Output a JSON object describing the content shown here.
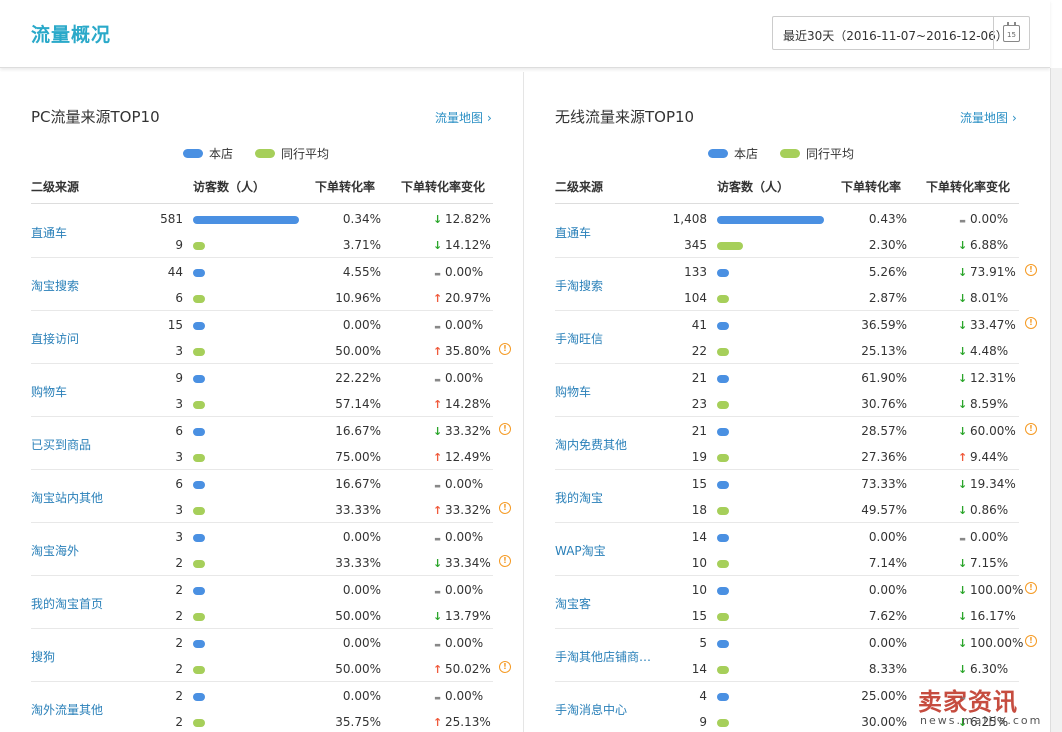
{
  "page_title": "流量概况",
  "date_range": "最近30天（2016-11-07~2016-12-06）",
  "calendar_day": "15",
  "colors": {
    "store": "#4a90e2",
    "peer": "#a6cf5a",
    "link": "#2a80b9",
    "title": "#2aa9c9"
  },
  "legend": {
    "store": "本店",
    "peer": "同行平均"
  },
  "columns": {
    "source": "二级来源",
    "visitors": "访客数（人）",
    "rate": "下单转化率",
    "change": "下单转化率变化"
  },
  "map_link": "流量地图",
  "panels": [
    {
      "title": "PC流量来源TOP10",
      "max_visitors": 581,
      "rows": [
        {
          "source": "直通车",
          "store": {
            "visitors": "581",
            "value": 581,
            "rate": "0.34%",
            "dir": "down",
            "change": "12.82%",
            "warn": false
          },
          "peer": {
            "visitors": "9",
            "value": 9,
            "rate": "3.71%",
            "dir": "down",
            "change": "14.12%",
            "warn": false
          }
        },
        {
          "source": "淘宝搜索",
          "store": {
            "visitors": "44",
            "value": 44,
            "rate": "4.55%",
            "dir": "flat",
            "change": "0.00%",
            "warn": false
          },
          "peer": {
            "visitors": "6",
            "value": 6,
            "rate": "10.96%",
            "dir": "up",
            "change": "20.97%",
            "warn": false
          }
        },
        {
          "source": "直接访问",
          "store": {
            "visitors": "15",
            "value": 15,
            "rate": "0.00%",
            "dir": "flat",
            "change": "0.00%",
            "warn": false
          },
          "peer": {
            "visitors": "3",
            "value": 3,
            "rate": "50.00%",
            "dir": "up",
            "change": "35.80%",
            "warn": true
          }
        },
        {
          "source": "购物车",
          "store": {
            "visitors": "9",
            "value": 9,
            "rate": "22.22%",
            "dir": "flat",
            "change": "0.00%",
            "warn": false
          },
          "peer": {
            "visitors": "3",
            "value": 3,
            "rate": "57.14%",
            "dir": "up",
            "change": "14.28%",
            "warn": false
          }
        },
        {
          "source": "已买到商品",
          "store": {
            "visitors": "6",
            "value": 6,
            "rate": "16.67%",
            "dir": "down",
            "change": "33.32%",
            "warn": true
          },
          "peer": {
            "visitors": "3",
            "value": 3,
            "rate": "75.00%",
            "dir": "up",
            "change": "12.49%",
            "warn": false
          }
        },
        {
          "source": "淘宝站内其他",
          "store": {
            "visitors": "6",
            "value": 6,
            "rate": "16.67%",
            "dir": "flat",
            "change": "0.00%",
            "warn": false
          },
          "peer": {
            "visitors": "3",
            "value": 3,
            "rate": "33.33%",
            "dir": "up",
            "change": "33.32%",
            "warn": true
          }
        },
        {
          "source": "淘宝海外",
          "store": {
            "visitors": "3",
            "value": 3,
            "rate": "0.00%",
            "dir": "flat",
            "change": "0.00%",
            "warn": false
          },
          "peer": {
            "visitors": "2",
            "value": 2,
            "rate": "33.33%",
            "dir": "down",
            "change": "33.34%",
            "warn": true
          }
        },
        {
          "source": "我的淘宝首页",
          "store": {
            "visitors": "2",
            "value": 2,
            "rate": "0.00%",
            "dir": "flat",
            "change": "0.00%",
            "warn": false
          },
          "peer": {
            "visitors": "2",
            "value": 2,
            "rate": "50.00%",
            "dir": "down",
            "change": "13.79%",
            "warn": false
          }
        },
        {
          "source": "搜狗",
          "store": {
            "visitors": "2",
            "value": 2,
            "rate": "0.00%",
            "dir": "flat",
            "change": "0.00%",
            "warn": false
          },
          "peer": {
            "visitors": "2",
            "value": 2,
            "rate": "50.00%",
            "dir": "up",
            "change": "50.02%",
            "warn": true
          }
        },
        {
          "source": "淘外流量其他",
          "store": {
            "visitors": "2",
            "value": 2,
            "rate": "0.00%",
            "dir": "flat",
            "change": "0.00%",
            "warn": false
          },
          "peer": {
            "visitors": "2",
            "value": 2,
            "rate": "35.75%",
            "dir": "up",
            "change": "25.13%",
            "warn": false
          }
        }
      ]
    },
    {
      "title": "无线流量来源TOP10",
      "max_visitors": 1408,
      "rows": [
        {
          "source": "直通车",
          "store": {
            "visitors": "1,408",
            "value": 1408,
            "rate": "0.43%",
            "dir": "flat",
            "change": "0.00%",
            "warn": false
          },
          "peer": {
            "visitors": "345",
            "value": 345,
            "rate": "2.30%",
            "dir": "down",
            "change": "6.88%",
            "warn": false
          }
        },
        {
          "source": "手淘搜索",
          "store": {
            "visitors": "133",
            "value": 133,
            "rate": "5.26%",
            "dir": "down",
            "change": "73.91%",
            "warn": true
          },
          "peer": {
            "visitors": "104",
            "value": 104,
            "rate": "2.87%",
            "dir": "down",
            "change": "8.01%",
            "warn": false
          }
        },
        {
          "source": "手淘旺信",
          "store": {
            "visitors": "41",
            "value": 41,
            "rate": "36.59%",
            "dir": "down",
            "change": "33.47%",
            "warn": true
          },
          "peer": {
            "visitors": "22",
            "value": 22,
            "rate": "25.13%",
            "dir": "down",
            "change": "4.48%",
            "warn": false
          }
        },
        {
          "source": "购物车",
          "store": {
            "visitors": "21",
            "value": 21,
            "rate": "61.90%",
            "dir": "down",
            "change": "12.31%",
            "warn": false
          },
          "peer": {
            "visitors": "23",
            "value": 23,
            "rate": "30.76%",
            "dir": "down",
            "change": "8.59%",
            "warn": false
          }
        },
        {
          "source": "淘内免费其他",
          "store": {
            "visitors": "21",
            "value": 21,
            "rate": "28.57%",
            "dir": "down",
            "change": "60.00%",
            "warn": true
          },
          "peer": {
            "visitors": "19",
            "value": 19,
            "rate": "27.36%",
            "dir": "up",
            "change": "9.44%",
            "warn": false
          }
        },
        {
          "source": "我的淘宝",
          "store": {
            "visitors": "15",
            "value": 15,
            "rate": "73.33%",
            "dir": "down",
            "change": "19.34%",
            "warn": false
          },
          "peer": {
            "visitors": "18",
            "value": 18,
            "rate": "49.57%",
            "dir": "down",
            "change": "0.86%",
            "warn": false
          }
        },
        {
          "source": "WAP淘宝",
          "store": {
            "visitors": "14",
            "value": 14,
            "rate": "0.00%",
            "dir": "flat",
            "change": "0.00%",
            "warn": false
          },
          "peer": {
            "visitors": "10",
            "value": 10,
            "rate": "7.14%",
            "dir": "down",
            "change": "7.15%",
            "warn": false
          }
        },
        {
          "source": "淘宝客",
          "store": {
            "visitors": "10",
            "value": 10,
            "rate": "0.00%",
            "dir": "down",
            "change": "100.00%",
            "warn": true
          },
          "peer": {
            "visitors": "15",
            "value": 15,
            "rate": "7.62%",
            "dir": "down",
            "change": "16.17%",
            "warn": false
          }
        },
        {
          "source": "手淘其他店铺商…",
          "store": {
            "visitors": "5",
            "value": 5,
            "rate": "0.00%",
            "dir": "down",
            "change": "100.00%",
            "warn": true
          },
          "peer": {
            "visitors": "14",
            "value": 14,
            "rate": "8.33%",
            "dir": "down",
            "change": "6.30%",
            "warn": false
          }
        },
        {
          "source": "手淘消息中心",
          "store": {
            "visitors": "4",
            "value": 4,
            "rate": "25.00%",
            "dir": "flat",
            "change": "",
            "warn": false
          },
          "peer": {
            "visitors": "9",
            "value": 9,
            "rate": "30.00%",
            "dir": "down",
            "change": "6.25%",
            "warn": false
          }
        }
      ]
    }
  ],
  "watermark": {
    "brand": "卖家资讯",
    "url": "news.maijia.com"
  }
}
